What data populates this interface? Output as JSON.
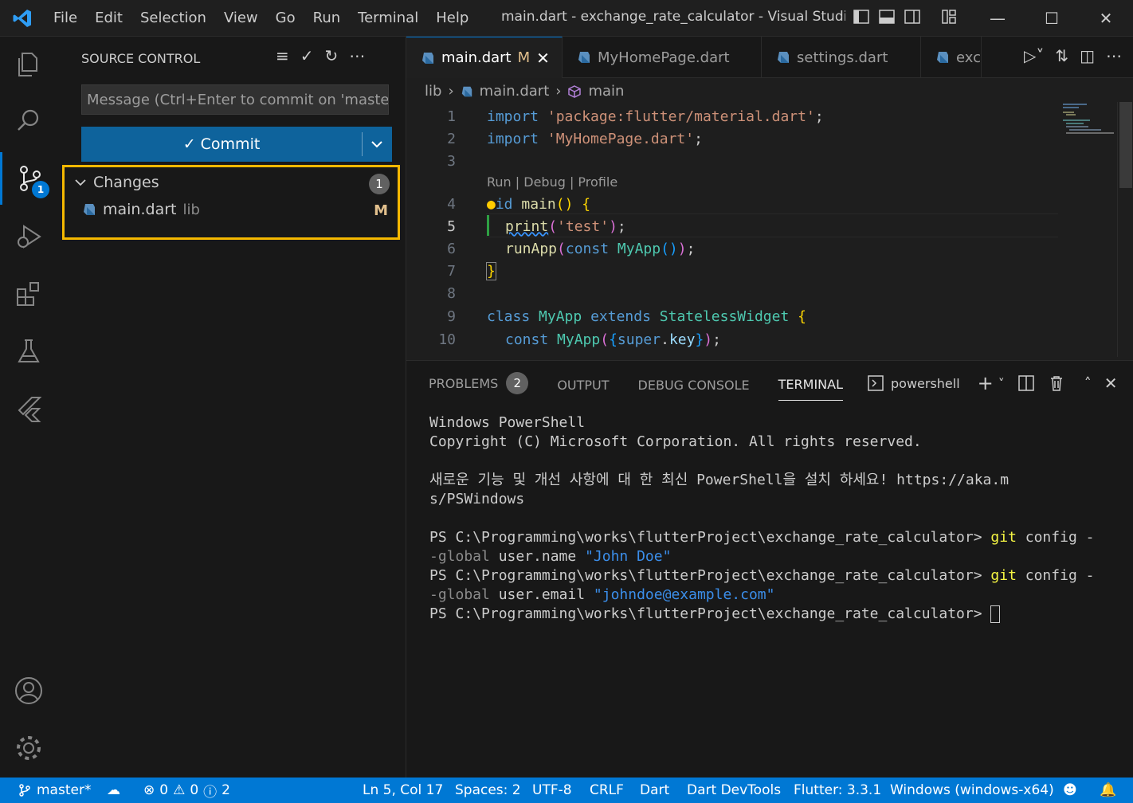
{
  "titlebar": {
    "menu": [
      "File",
      "Edit",
      "Selection",
      "View",
      "Go",
      "Run",
      "Terminal",
      "Help"
    ],
    "title": "main.dart - exchange_rate_calculator - Visual Studio ..."
  },
  "activity": {
    "source_control_badge": "1"
  },
  "sidebar": {
    "header": "SOURCE CONTROL",
    "commit_placeholder": "Message (Ctrl+Enter to commit on 'master')",
    "commit_label": "Commit",
    "changes": {
      "label": "Changes",
      "count": "1",
      "files": [
        {
          "name": "main.dart",
          "dir": "lib",
          "status": "M"
        }
      ]
    }
  },
  "tabs": [
    {
      "label": "main.dart",
      "modified": "M",
      "active": true
    },
    {
      "label": "MyHomePage.dart"
    },
    {
      "label": "settings.dart"
    },
    {
      "label": "exc"
    }
  ],
  "breadcrumb": {
    "folder": "lib",
    "file": "main.dart",
    "symbol": "main"
  },
  "code": {
    "codelens": "Run | Debug | Profile",
    "line_numbers": [
      "1",
      "2",
      "3",
      "4",
      "5",
      "6",
      "7",
      "8",
      "9",
      "10"
    ]
  },
  "panel": {
    "tabs": {
      "problems": "PROBLEMS",
      "problems_count": "2",
      "output": "OUTPUT",
      "debug_console": "DEBUG CONSOLE",
      "terminal": "TERMINAL"
    },
    "shell": "powershell",
    "terminal_lines": {
      "l1": "Windows PowerShell",
      "l2": "Copyright (C) Microsoft Corporation. All rights reserved.",
      "l3": "새로운 기능 및 개선 사항에 대 한 최신 PowerShell을 설치 하세요! https://aka.m",
      "l4": "s/PSWindows",
      "prompt": "PS C:\\Programming\\works\\flutterProject\\exchange_rate_calculator> ",
      "cmd": "git",
      "cmd_rest": " config -",
      "l5b_flag": "-global",
      "l5b_arg": " user.name ",
      "l5b_val": "\"John Doe\"",
      "l6b_arg": " user.email ",
      "l6b_val": "\"johndoe@example.com\""
    }
  },
  "statusbar": {
    "branch": "master*",
    "errors": "0",
    "warnings": "0",
    "infos": "2",
    "position": "Ln 5, Col 17",
    "spaces": "Spaces: 2",
    "encoding": "UTF-8",
    "eol": "CRLF",
    "language": "Dart",
    "devtools": "Dart DevTools",
    "flutter": "Flutter: 3.3.1",
    "device": "Windows (windows-x64)"
  }
}
